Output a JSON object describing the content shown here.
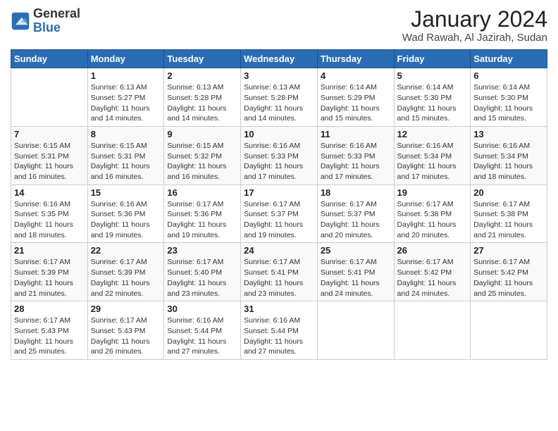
{
  "logo": {
    "general": "General",
    "blue": "Blue"
  },
  "title": "January 2024",
  "subtitle": "Wad Rawah, Al Jazirah, Sudan",
  "weekdays": [
    "Sunday",
    "Monday",
    "Tuesday",
    "Wednesday",
    "Thursday",
    "Friday",
    "Saturday"
  ],
  "weeks": [
    [
      {
        "day": "",
        "info": ""
      },
      {
        "day": "1",
        "info": "Sunrise: 6:13 AM\nSunset: 5:27 PM\nDaylight: 11 hours\nand 14 minutes."
      },
      {
        "day": "2",
        "info": "Sunrise: 6:13 AM\nSunset: 5:28 PM\nDaylight: 11 hours\nand 14 minutes."
      },
      {
        "day": "3",
        "info": "Sunrise: 6:13 AM\nSunset: 5:28 PM\nDaylight: 11 hours\nand 14 minutes."
      },
      {
        "day": "4",
        "info": "Sunrise: 6:14 AM\nSunset: 5:29 PM\nDaylight: 11 hours\nand 15 minutes."
      },
      {
        "day": "5",
        "info": "Sunrise: 6:14 AM\nSunset: 5:30 PM\nDaylight: 11 hours\nand 15 minutes."
      },
      {
        "day": "6",
        "info": "Sunrise: 6:14 AM\nSunset: 5:30 PM\nDaylight: 11 hours\nand 15 minutes."
      }
    ],
    [
      {
        "day": "7",
        "info": "Sunrise: 6:15 AM\nSunset: 5:31 PM\nDaylight: 11 hours\nand 16 minutes."
      },
      {
        "day": "8",
        "info": "Sunrise: 6:15 AM\nSunset: 5:31 PM\nDaylight: 11 hours\nand 16 minutes."
      },
      {
        "day": "9",
        "info": "Sunrise: 6:15 AM\nSunset: 5:32 PM\nDaylight: 11 hours\nand 16 minutes."
      },
      {
        "day": "10",
        "info": "Sunrise: 6:16 AM\nSunset: 5:33 PM\nDaylight: 11 hours\nand 17 minutes."
      },
      {
        "day": "11",
        "info": "Sunrise: 6:16 AM\nSunset: 5:33 PM\nDaylight: 11 hours\nand 17 minutes."
      },
      {
        "day": "12",
        "info": "Sunrise: 6:16 AM\nSunset: 5:34 PM\nDaylight: 11 hours\nand 17 minutes."
      },
      {
        "day": "13",
        "info": "Sunrise: 6:16 AM\nSunset: 5:34 PM\nDaylight: 11 hours\nand 18 minutes."
      }
    ],
    [
      {
        "day": "14",
        "info": "Sunrise: 6:16 AM\nSunset: 5:35 PM\nDaylight: 11 hours\nand 18 minutes."
      },
      {
        "day": "15",
        "info": "Sunrise: 6:16 AM\nSunset: 5:36 PM\nDaylight: 11 hours\nand 19 minutes."
      },
      {
        "day": "16",
        "info": "Sunrise: 6:17 AM\nSunset: 5:36 PM\nDaylight: 11 hours\nand 19 minutes."
      },
      {
        "day": "17",
        "info": "Sunrise: 6:17 AM\nSunset: 5:37 PM\nDaylight: 11 hours\nand 19 minutes."
      },
      {
        "day": "18",
        "info": "Sunrise: 6:17 AM\nSunset: 5:37 PM\nDaylight: 11 hours\nand 20 minutes."
      },
      {
        "day": "19",
        "info": "Sunrise: 6:17 AM\nSunset: 5:38 PM\nDaylight: 11 hours\nand 20 minutes."
      },
      {
        "day": "20",
        "info": "Sunrise: 6:17 AM\nSunset: 5:38 PM\nDaylight: 11 hours\nand 21 minutes."
      }
    ],
    [
      {
        "day": "21",
        "info": "Sunrise: 6:17 AM\nSunset: 5:39 PM\nDaylight: 11 hours\nand 21 minutes."
      },
      {
        "day": "22",
        "info": "Sunrise: 6:17 AM\nSunset: 5:39 PM\nDaylight: 11 hours\nand 22 minutes."
      },
      {
        "day": "23",
        "info": "Sunrise: 6:17 AM\nSunset: 5:40 PM\nDaylight: 11 hours\nand 23 minutes."
      },
      {
        "day": "24",
        "info": "Sunrise: 6:17 AM\nSunset: 5:41 PM\nDaylight: 11 hours\nand 23 minutes."
      },
      {
        "day": "25",
        "info": "Sunrise: 6:17 AM\nSunset: 5:41 PM\nDaylight: 11 hours\nand 24 minutes."
      },
      {
        "day": "26",
        "info": "Sunrise: 6:17 AM\nSunset: 5:42 PM\nDaylight: 11 hours\nand 24 minutes."
      },
      {
        "day": "27",
        "info": "Sunrise: 6:17 AM\nSunset: 5:42 PM\nDaylight: 11 hours\nand 25 minutes."
      }
    ],
    [
      {
        "day": "28",
        "info": "Sunrise: 6:17 AM\nSunset: 5:43 PM\nDaylight: 11 hours\nand 25 minutes."
      },
      {
        "day": "29",
        "info": "Sunrise: 6:17 AM\nSunset: 5:43 PM\nDaylight: 11 hours\nand 26 minutes."
      },
      {
        "day": "30",
        "info": "Sunrise: 6:16 AM\nSunset: 5:44 PM\nDaylight: 11 hours\nand 27 minutes."
      },
      {
        "day": "31",
        "info": "Sunrise: 6:16 AM\nSunset: 5:44 PM\nDaylight: 11 hours\nand 27 minutes."
      },
      {
        "day": "",
        "info": ""
      },
      {
        "day": "",
        "info": ""
      },
      {
        "day": "",
        "info": ""
      }
    ]
  ]
}
